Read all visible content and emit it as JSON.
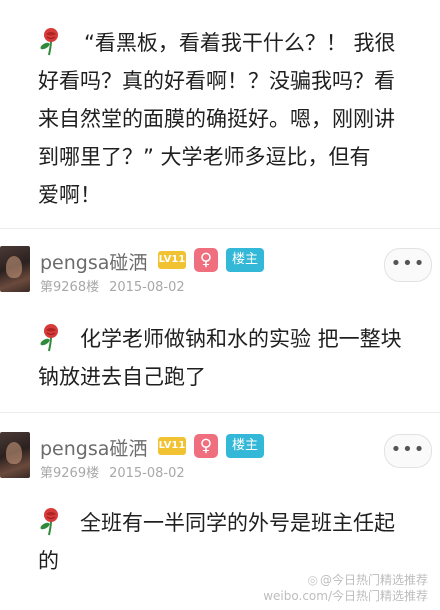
{
  "posts": [
    {
      "lines": [
        "“看黑板，看着我干什么？！ 我很",
        "好看吗？真的好看啊！？没骗我吗？看",
        "来自然堂的面膜的确挺好。嗯，刚刚讲",
        "到哪里了？” 大学老师多逗比，但有",
        "爱啊！"
      ]
    },
    {
      "lines": [
        "化学老师做钠和水的实验 把一整块",
        "钠放进去自己跑了"
      ]
    },
    {
      "lines": [
        "全班有一半同学的外号是班主任起",
        "的"
      ]
    }
  ],
  "replies": [
    {
      "username": "pengsa碰洒",
      "level": "LV11",
      "gender_symbol": "♀",
      "owner_badge": "楼主",
      "floor": "第9268楼",
      "date": "2015-08-02",
      "more_label": "•••"
    },
    {
      "username": "pengsa碰洒",
      "level": "LV11",
      "gender_symbol": "♀",
      "owner_badge": "楼主",
      "floor": "第9269楼",
      "date": "2015-08-02",
      "more_label": "•••"
    }
  ],
  "watermark": {
    "line1": "@今日热门精选推荐",
    "line2": "weibo.com/今日热门精选推荐"
  },
  "icons": {
    "post_icon": "rose-icon",
    "avatar": "avatar-image",
    "more": "more-options-icon",
    "weibo": "weibo-logo-icon"
  },
  "colors": {
    "level_badge": "#f1c232",
    "gender_badge": "#ef6f7f",
    "owner_badge": "#33b8d8",
    "rose_red": "#d63a3a",
    "rose_green": "#2f8a3a"
  }
}
